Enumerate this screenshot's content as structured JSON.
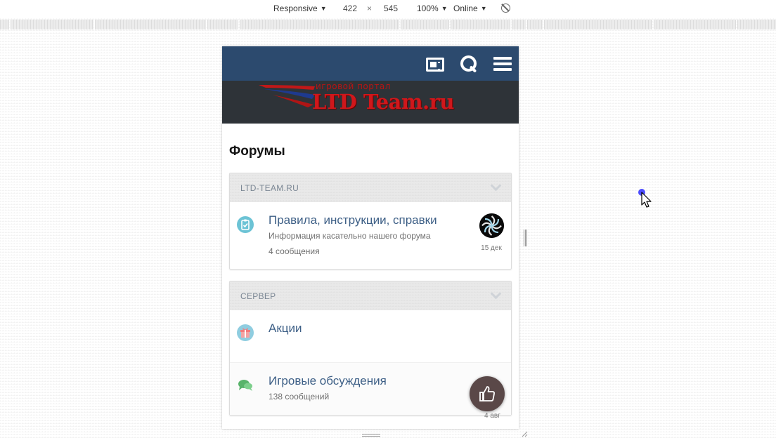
{
  "devtools": {
    "device": "Responsive",
    "width": "422",
    "times": "×",
    "height": "545",
    "zoom": "100%",
    "network": "Online"
  },
  "site": {
    "logo_tagline": "игровой портал",
    "logo_text": "LTD Team.ru",
    "page_title": "Форумы",
    "topbar_color": "#2c4a6e",
    "link_color": "#3d5f86"
  },
  "sections": [
    {
      "title": "LTD-TEAM.RU",
      "forums": [
        {
          "icon": "clipboard-check-icon",
          "name": "Правила, инструкции, справки",
          "description": "Информация касательно нашего форума",
          "count": "4 сообщения",
          "last_date": "15 дек"
        }
      ]
    },
    {
      "title": "СЕРВЕР",
      "forums": [
        {
          "icon": "gift-icon",
          "name": "Акции"
        },
        {
          "icon": "chat-bubbles-icon",
          "name": "Игровые обсуждения",
          "count": "138 сообщений",
          "last_date": "4 авг"
        }
      ]
    }
  ]
}
